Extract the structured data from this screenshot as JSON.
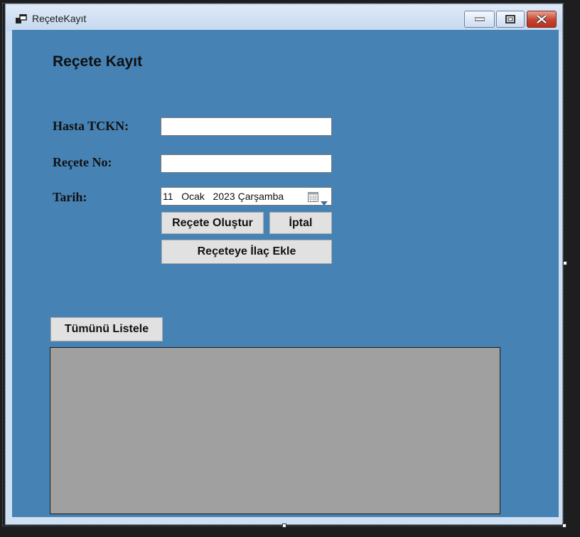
{
  "window": {
    "title": "ReçeteKayıt",
    "icons": {
      "app": "form-icon",
      "minimize": "minimize-icon",
      "maximize": "maximize-icon",
      "close": "close-icon"
    }
  },
  "form": {
    "heading": "Reçete Kayıt",
    "tckn_label": "Hasta TCKN:",
    "tckn_value": "",
    "recete_no_label": "Reçete No:",
    "recete_no_value": "",
    "tarih_label": "Tarih:",
    "tarih_value": "11   Ocak   2023 Çarşamba",
    "tarih_icon": "calendar-icon"
  },
  "buttons": {
    "olustur": "Reçete Oluştur",
    "iptal": "İptal",
    "ilac_ekle": "Reçeteye İlaç Ekle",
    "listele": "Tümünü Listele"
  },
  "colors": {
    "client_bg": "#4682b4",
    "grid_bg": "#a0a0a0",
    "button_bg": "#e1e1e1",
    "close_red": "#c5432f"
  }
}
